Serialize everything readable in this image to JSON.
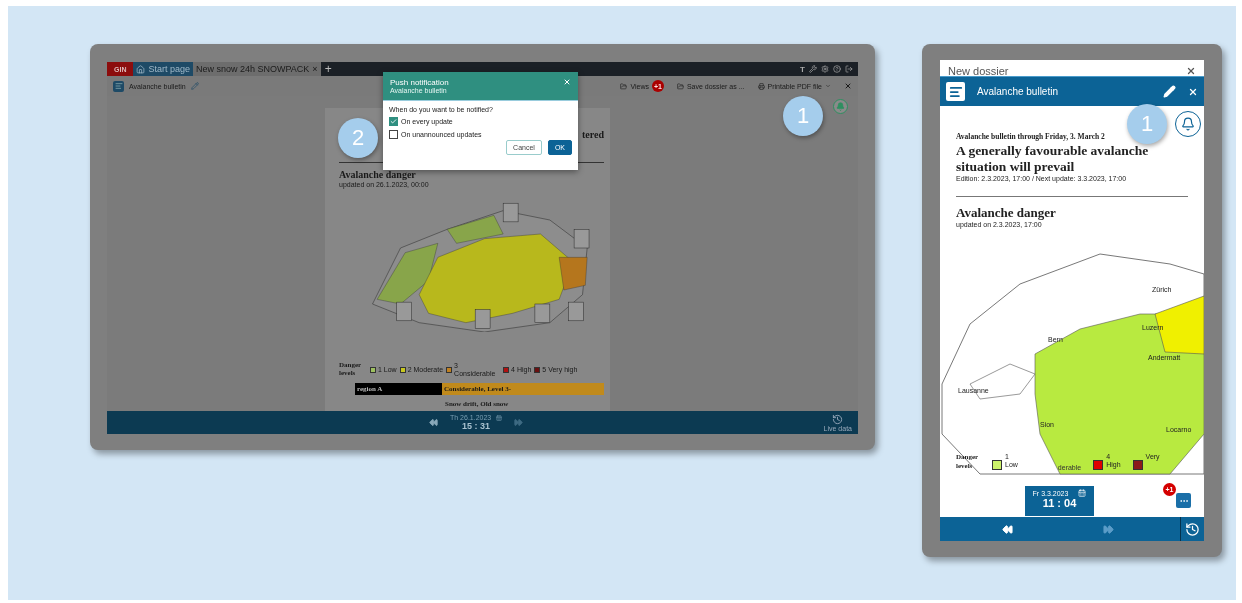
{
  "left_screen": {
    "tabs": [
      {
        "label": "GIN",
        "kind": "brand",
        "selected": false
      },
      {
        "label": "Start page",
        "kind": "home",
        "selected": false
      },
      {
        "label": "New snow 24h SNOWPACK",
        "kind": "dossier",
        "selected": true
      }
    ],
    "tab_close": "×",
    "add_tab": "+",
    "text_tool": "T",
    "panel": {
      "title": "Avalanche bulletin"
    },
    "toolbar": [
      {
        "label": "Views",
        "kind": "folder",
        "badge": "+1"
      },
      {
        "label": "Save dossier as ...",
        "kind": "folder"
      },
      {
        "label": "Printable PDF file",
        "kind": "print"
      }
    ],
    "document": {
      "title_fragment": "tered",
      "section": "Avalanche danger",
      "updated": "updated on 26.1.2023, 00:00",
      "legend_title": "Danger levels",
      "legend": [
        {
          "label": "1 Low",
          "color": "#9dc060"
        },
        {
          "label": "2 Moderate",
          "color": "#c8c820"
        },
        {
          "label": "3 Considerable",
          "color": "#c08020"
        },
        {
          "label": "4 High",
          "color": "#b01010"
        },
        {
          "label": "5 Very high",
          "color": "#6a1010"
        }
      ],
      "region": "region A",
      "rating": "Considerable, Level 3-",
      "problem": "Snow drift, Old snow"
    },
    "timebar": {
      "date": "Th 26.1.2023",
      "time": "15 : 31",
      "live_label": "Live data"
    },
    "dialog": {
      "title": "Push notification",
      "subtitle": "Avalanche bulletin",
      "question": "When do you want to be notified?",
      "options": [
        {
          "label": "On every update",
          "checked": true
        },
        {
          "label": "On unannounced updates",
          "checked": false
        }
      ],
      "buttons": [
        {
          "label": "Cancel",
          "kind": "secondary"
        },
        {
          "label": "OK",
          "kind": "primary"
        }
      ]
    },
    "dialog_callout": "2",
    "bell_callout": "1"
  },
  "right_screen": {
    "dossier_title": "New dossier",
    "panel": {
      "title": "Avalanche bulletin"
    },
    "bell_callout": "1",
    "document": {
      "kicker": "Avalanche bulletin through Friday, 3. March 2",
      "headline": "A generally favourable avalanche situation will prevail",
      "edition": "Edition: 2.3.2023, 17:00 / Next update: 3.3.2023, 17:00",
      "section": "Avalanche danger",
      "updated": "updated on 2.3.2023, 17:00",
      "map_labels": [
        "Zürich",
        "Luzern",
        "Bern",
        "Andermatt",
        "Lausanne",
        "Sion",
        "Locarno"
      ],
      "legend_title": "Danger levels",
      "legend": [
        {
          "kind": "swatch",
          "number": "1",
          "label": "Low",
          "color": "#ccf26a"
        },
        {
          "kind": "text",
          "label": "derable"
        },
        {
          "kind": "swatch",
          "number": "4",
          "label": "High",
          "color": "#e00000"
        },
        {
          "kind": "swatch",
          "label": "Very",
          "color": "#8b1a1a"
        }
      ]
    },
    "timebar": {
      "date": "Fr 3.3.2023",
      "time": "11 : 04"
    },
    "more_badge": "+1"
  }
}
